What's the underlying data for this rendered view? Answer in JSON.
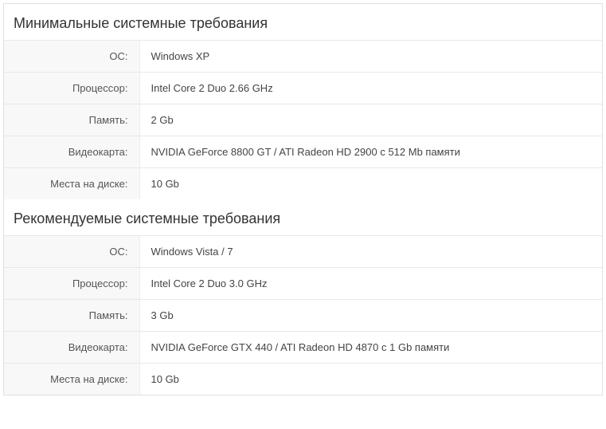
{
  "sections": [
    {
      "title": "Минимальные системные требования",
      "rows": [
        {
          "label": "ОС:",
          "value": "Windows XP"
        },
        {
          "label": "Процессор:",
          "value": "Intel Core 2 Duo 2.66 GHz"
        },
        {
          "label": "Память:",
          "value": "2 Gb"
        },
        {
          "label": "Видеокарта:",
          "value": "NVIDIA GeForce 8800 GT / ATI Radeon HD 2900 с 512 Mb памяти"
        },
        {
          "label": "Места на диске:",
          "value": "10 Gb"
        }
      ]
    },
    {
      "title": "Рекомендуемые системные требования",
      "rows": [
        {
          "label": "ОС:",
          "value": "Windows Vista / 7"
        },
        {
          "label": "Процессор:",
          "value": "Intel Core 2 Duo 3.0 GHz"
        },
        {
          "label": "Память:",
          "value": "3 Gb"
        },
        {
          "label": "Видеокарта:",
          "value": "NVIDIA GeForce GTX 440 / ATI Radeon HD 4870 с 1 Gb памяти"
        },
        {
          "label": "Места на диске:",
          "value": "10 Gb"
        }
      ]
    }
  ]
}
